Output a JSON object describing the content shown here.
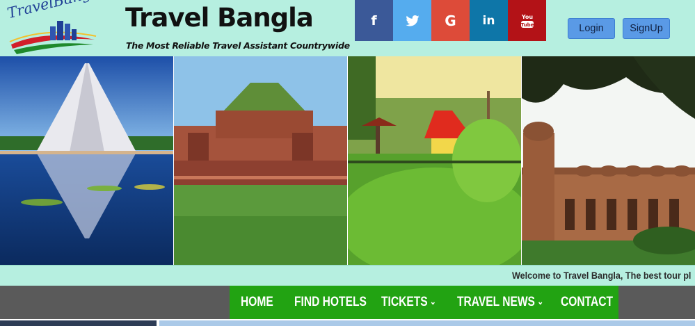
{
  "header": {
    "logo_text": "TravelBangla",
    "site_title": "Travel Bangla",
    "tagline": "The Most Reliable Travel Assistant Countrywide"
  },
  "social": [
    {
      "name": "facebook",
      "glyph": "f",
      "color": "#3b5998"
    },
    {
      "name": "twitter",
      "glyph": "twitter-bird",
      "color": "#55acee"
    },
    {
      "name": "google",
      "glyph": "G",
      "color": "#dd4b39"
    },
    {
      "name": "linkedin",
      "glyph": "in",
      "color": "#0e76a8"
    },
    {
      "name": "youtube",
      "glyph": "You Tube",
      "color": "#b31217"
    }
  ],
  "auth": {
    "login_label": "Login",
    "signup_label": "SignUp"
  },
  "marquee": {
    "text": "Welcome to Travel Bangla, The best tour pl"
  },
  "nav": {
    "items": [
      {
        "label": "HOME",
        "has_dropdown": false
      },
      {
        "label": "FIND HOTELS",
        "has_dropdown": false
      },
      {
        "label": "TICKETS",
        "has_dropdown": true
      },
      {
        "label": "TRAVEL NEWS",
        "has_dropdown": true
      },
      {
        "label": "CONTACT",
        "has_dropdown": false
      }
    ]
  },
  "colors": {
    "header_bg": "#b6efe0",
    "nav_green": "#22a312",
    "nav_gray": "#5a5a5a",
    "button_blue": "#5a9ae6"
  }
}
